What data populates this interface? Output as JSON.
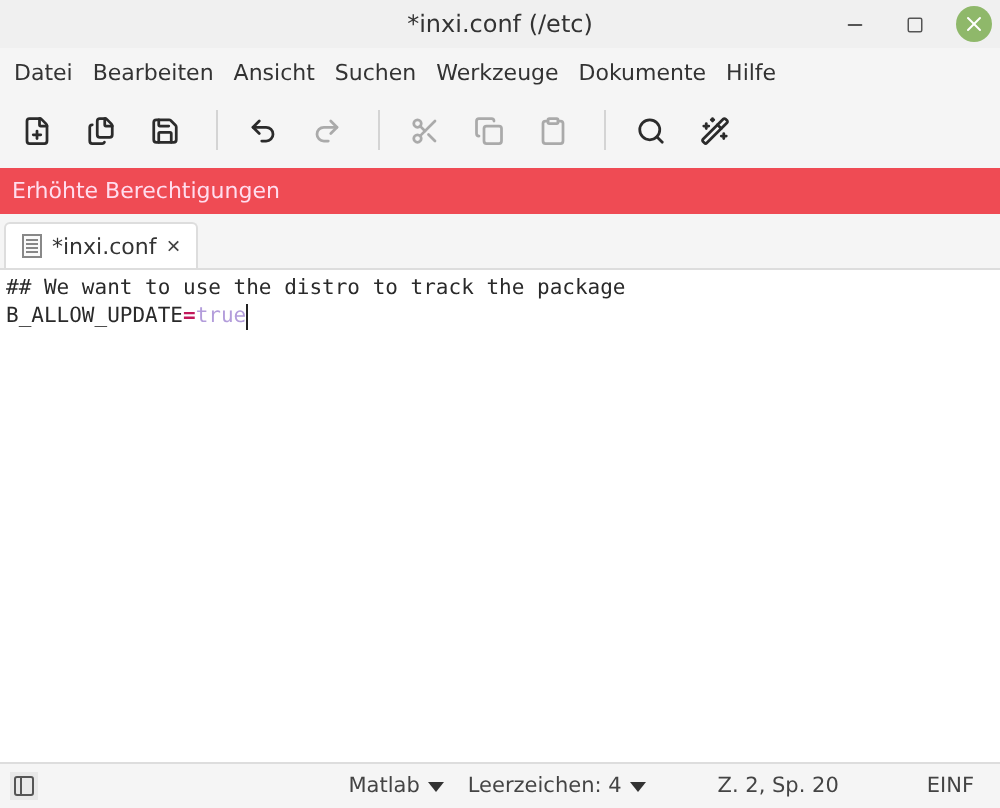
{
  "window": {
    "title": "*inxi.conf (/etc)"
  },
  "menu": [
    "Datei",
    "Bearbeiten",
    "Ansicht",
    "Suchen",
    "Werkzeuge",
    "Dokumente",
    "Hilfe"
  ],
  "toolbar": [
    {
      "kind": "new",
      "disabled": false
    },
    {
      "kind": "open",
      "disabled": false
    },
    {
      "kind": "save",
      "disabled": false
    },
    {
      "kind": "sep"
    },
    {
      "kind": "undo",
      "disabled": false
    },
    {
      "kind": "redo",
      "disabled": true
    },
    {
      "kind": "sep"
    },
    {
      "kind": "cut",
      "disabled": true
    },
    {
      "kind": "copy",
      "disabled": true
    },
    {
      "kind": "paste",
      "disabled": true
    },
    {
      "kind": "sep"
    },
    {
      "kind": "search",
      "disabled": false
    },
    {
      "kind": "replace",
      "disabled": false
    }
  ],
  "infobar": {
    "text": "Erhöhte Berechtigungen"
  },
  "tabs": [
    {
      "label": "*inxi.conf",
      "selected": true,
      "close": "×"
    }
  ],
  "editor": {
    "lines": [
      {
        "cursor": false,
        "segments": [
          {
            "kind": "plain",
            "text": "## We want to use the distro to track the package"
          }
        ]
      },
      {
        "cursor": true,
        "segments": [
          {
            "kind": "plain",
            "text": "B_ALLOW_UPDATE"
          },
          {
            "kind": "operator",
            "text": "="
          },
          {
            "kind": "value",
            "text": "true"
          }
        ]
      }
    ]
  },
  "status_bar": {
    "language": "Matlab",
    "indent": "Leerzeichen: 4",
    "position": "Z. 2, Sp. 20",
    "mode": "EINF"
  }
}
